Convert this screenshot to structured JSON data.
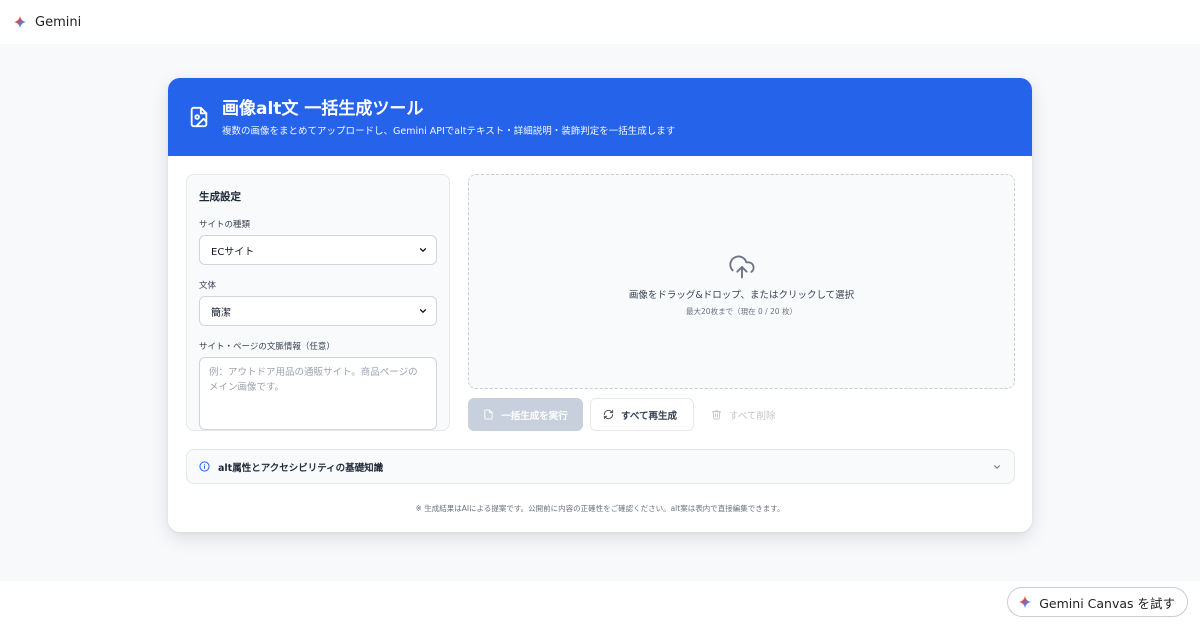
{
  "app": {
    "name": "Gemini"
  },
  "tool": {
    "title": "画像alt文 一括生成ツール",
    "subtitle": "複数の画像をまとめてアップロードし、Gemini APIでaltテキスト・詳細説明・装飾判定を一括生成します"
  },
  "settings": {
    "heading": "生成設定",
    "site_type_label": "サイトの種類",
    "site_type_value": "ECサイト",
    "style_label": "文体",
    "style_value": "簡潔",
    "context_label": "サイト・ページの文脈情報（任意）",
    "context_placeholder": "例：アウトドア用品の通販サイト。商品ページのメイン画像です。"
  },
  "dropzone": {
    "title": "画像をドラッグ&ドロップ、またはクリックして選択",
    "subtitle": "最大20枚まで（現在 0 / 20 枚）"
  },
  "actions": {
    "generate": "一括生成を実行",
    "regenerate": "すべて再生成",
    "delete": "すべて削除"
  },
  "accordion": {
    "title": "alt属性とアクセシビリティの基礎知識"
  },
  "footnote": "※ 生成結果はAIによる提案です。公開前に内容の正確性をご確認ください。alt案は表内で直接編集できます。",
  "canvas_button": "Gemini Canvas を試す",
  "colors": {
    "accent": "#2563eb",
    "disabled": "#c7d0dc"
  }
}
